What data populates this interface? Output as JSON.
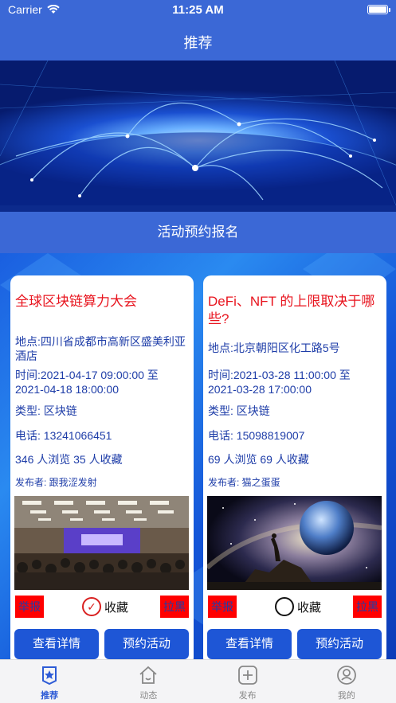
{
  "status_bar": {
    "carrier": "Carrier",
    "time": "11:25 AM"
  },
  "nav": {
    "title": "推荐"
  },
  "section": {
    "title": "活动预约报名"
  },
  "cards": [
    {
      "title": "全球区块链算力大会",
      "location": "地点:四川省成都市高新区盛美利亚酒店",
      "time": "时间:2021-04-17 09:00:00 至 2021-04-18 18:00:00",
      "type": "类型:  区块链",
      "phone": "电话:  13241066451",
      "stats": "346 人浏览   35 人收藏",
      "publisher": "发布者:  跟我涩发射",
      "report": "举报",
      "favorite": "收藏",
      "favorited": true,
      "block": "拉黑",
      "detail_button": "查看详情",
      "reserve_button": "预约活动"
    },
    {
      "title": "DeFi、NFT 的上限取决于哪些?",
      "location": "地点:北京朝阳区化工路5号",
      "time": "时间:2021-03-28 11:00:00 至 2021-03-28 17:00:00",
      "type": "类型:  区块链",
      "phone": "电话:  15098819007",
      "stats": " 69 人浏览   69 人收藏",
      "publisher": "发布者:  猫之蛋蛋",
      "report": "举报",
      "favorite": "收藏",
      "favorited": false,
      "block": "拉黑",
      "detail_button": "查看详情",
      "reserve_button": "预约活动"
    }
  ],
  "tabbar": [
    {
      "label": "推荐",
      "icon": "star-badge-icon",
      "active": true
    },
    {
      "label": "动态",
      "icon": "home-icon",
      "active": false
    },
    {
      "label": "发布",
      "icon": "plus-square-icon",
      "active": false
    },
    {
      "label": "我的",
      "icon": "user-circle-icon",
      "active": false
    }
  ],
  "colors": {
    "nav": "#3b68d6",
    "title_red": "#e8141e",
    "text_blue": "#1e3da8",
    "button": "#1e56d6",
    "tab_active": "#2d5bd6"
  }
}
